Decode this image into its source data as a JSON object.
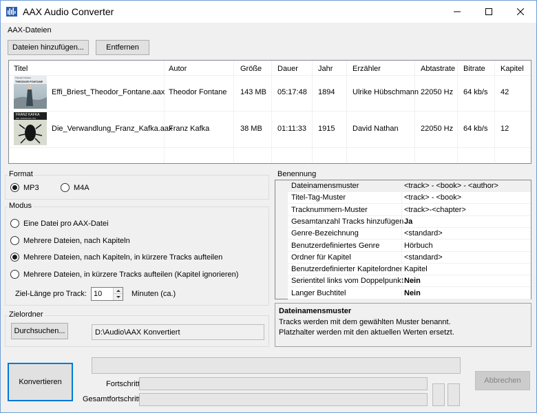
{
  "window": {
    "title": "AAX Audio Converter"
  },
  "files_group": {
    "title": "AAX-Dateien",
    "add_button": "Dateien hinzufügen...",
    "remove_button": "Entfernen",
    "columns": [
      "Titel",
      "Autor",
      "Größe",
      "Dauer",
      "Jahr",
      "Erzähler",
      "Abtastrate",
      "Bitrate",
      "Kapitel"
    ],
    "rows": [
      {
        "cover_text_top": "Theodor Fontane",
        "cover_text_main": "THEODOR FONTANE",
        "title": "Effi_Briest_Theodor_Fontane.aax",
        "author": "Theodor Fontane",
        "size": "143 MB",
        "duration": "05:17:48",
        "year": "1894",
        "narrator": "Ulrike Hübschmann",
        "samplerate": "22050 Hz",
        "bitrate": "64 kb/s",
        "chapters": "42"
      },
      {
        "cover_text_top": "FRANZ KAFKA",
        "cover_text_main": "DIE VERWANDLUNG",
        "title": "Die_Verwandlung_Franz_Kafka.aax",
        "author": "Franz Kafka",
        "size": "38 MB",
        "duration": "01:11:33",
        "year": "1915",
        "narrator": "David Nathan",
        "samplerate": "22050 Hz",
        "bitrate": "64 kb/s",
        "chapters": "12"
      }
    ]
  },
  "format_group": {
    "title": "Format",
    "mp3": "MP3",
    "m4a": "M4A",
    "selected": "mp3"
  },
  "mode_group": {
    "title": "Modus",
    "options": [
      "Eine Datei pro AAX-Datei",
      "Mehrere Dateien, nach Kapiteln",
      "Mehrere Dateien, nach Kapiteln, in kürzere Tracks aufteilen",
      "Mehrere Dateien, in kürzere Tracks aufteilen (Kapitel ignorieren)"
    ],
    "selected_index": 2,
    "length_label": "Ziel-Länge pro Track:",
    "length_value": "10",
    "length_unit": "Minuten (ca.)"
  },
  "target_group": {
    "title": "Zielordner",
    "browse_button": "Durchsuchen...",
    "path": "D:\\Audio\\AAX Konvertiert"
  },
  "naming_group": {
    "title": "Benennung",
    "properties": [
      {
        "name": "Dateinamensmuster",
        "value": "<track> - <book> - <author>",
        "bold": false
      },
      {
        "name": "Titel-Tag-Muster",
        "value": "<track> - <book>",
        "bold": false
      },
      {
        "name": "Tracknummern-Muster",
        "value": "<track>-<chapter>",
        "bold": false
      },
      {
        "name": "Gesamtanzahl Tracks hinzufügen",
        "value": "Ja",
        "bold": true
      },
      {
        "name": "Genre-Bezeichnung",
        "value": "<standard>",
        "bold": false
      },
      {
        "name": "Benutzerdefiniertes Genre",
        "value": "Hörbuch",
        "bold": false
      },
      {
        "name": "Ordner für Kapitel",
        "value": "<standard>",
        "bold": false
      },
      {
        "name": "Benutzerdefinierter Kapitelordner",
        "value": "Kapitel",
        "bold": false
      },
      {
        "name": "Serientitel links vom Doppelpunkt",
        "value": "Nein",
        "bold": true
      },
      {
        "name": "Langer Buchtitel",
        "value": "Nein",
        "bold": true
      }
    ],
    "help_title": "Dateinamensmuster",
    "help_text_1": "Tracks werden mit dem gewählten Muster benannt.",
    "help_text_2": "Platzhalter werden mit den aktuellen Werten ersetzt."
  },
  "bottom": {
    "convert_button": "Konvertieren",
    "progress_label": "Fortschritt:",
    "total_progress_label": "Gesamtfortschritt:",
    "cancel_button": "Abbrechen"
  },
  "colors": {
    "accent": "#0078d7",
    "background": "#f0f0f0"
  }
}
